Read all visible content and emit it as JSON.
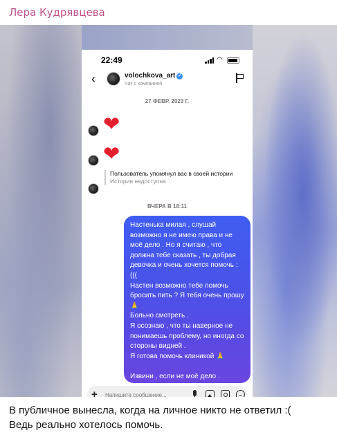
{
  "sender_name": "Лера Кудрявцева",
  "colors": {
    "sender": "#c0508a",
    "bubble_top": "#3f5df2",
    "bubble_bottom": "#6a45e0",
    "heart": "#e4202e",
    "verified": "#3b8ff5"
  },
  "screenshot": {
    "status_bar": {
      "time": "22:49"
    },
    "header": {
      "back_icon": "back-arrow-icon",
      "username": "volochkova_art",
      "verified_icon": "✓",
      "subtitle": "Чат с компанией",
      "flag_icon": "flag-icon"
    },
    "date_divider_1": "27 ФЕВР. 2023 Г.",
    "hearts": [
      "❤",
      "❤"
    ],
    "mention": {
      "title": "Пользователь упомянул вас в своей истории",
      "subtitle": "История недоступна"
    },
    "date_divider_2": "ВЧЕРА В 18:11",
    "message": {
      "line1": "Настенька милая , слушай возможно я не имею права и не моё дело . Но я считаю , что должна тебе сказать , ты добрая девочка и очень хочется помочь :(((",
      "line2": "Настен возможно тебе помочь бросить пить ? Я тебя очень прошу 🙏",
      "line3": "Больно смотреть .",
      "line4": "Я осознаю , что ты наверное не понимаешь проблему, но иногда со стороны видней .",
      "line5": "Я готова помочь клиникой 🙏",
      "line6": "Извини , если не моё дело ."
    },
    "composer": {
      "plus": "+",
      "placeholder": "Напишите сообщение..."
    }
  },
  "caption": {
    "line1": "В публичное вынесла, когда на личное никто не ответил  :(",
    "line2": "Ведь реально хотелось помочь."
  }
}
